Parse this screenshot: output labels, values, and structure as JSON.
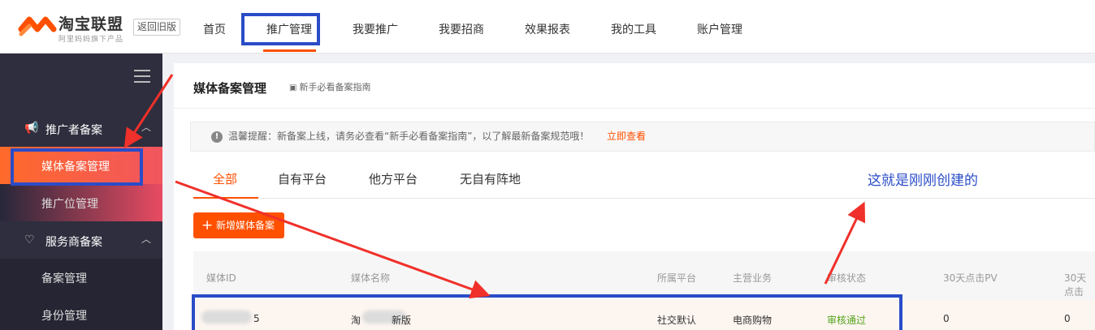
{
  "header": {
    "brand": "淘宝联盟",
    "brand_sub": "阿里妈妈旗下产品",
    "old_version": "返回旧版",
    "nav": [
      "首页",
      "推广管理",
      "我要推广",
      "我要招商",
      "效果报表",
      "我的工具",
      "账户管理"
    ]
  },
  "sidebar": {
    "groups": [
      {
        "label": "推广者备案",
        "items": [
          "媒体备案管理",
          "推广位管理"
        ]
      },
      {
        "label": "服务商备案",
        "items": [
          "备案管理",
          "身份管理"
        ]
      }
    ]
  },
  "main": {
    "title": "媒体备案管理",
    "guide_link": "新手必看备案指南",
    "notice_text": "温馨提醒：新备案上线，请务必查看“新手必看备案指南”，以了解最新备案规范哦！",
    "notice_link": "立即查看",
    "tabs": [
      "全部",
      "自有平台",
      "他方平台",
      "无自有阵地"
    ],
    "add_button": "新增媒体备案",
    "annotation": "这就是刚刚创建的",
    "table": {
      "headers": [
        "媒体ID",
        "媒体名称",
        "所属平台",
        "主营业务",
        "审核状态",
        "30天点击PV",
        "30天点击"
      ],
      "row": {
        "id": "5",
        "name_prefix": "淘",
        "name_suffix": "新版",
        "platform": "社交默认",
        "business": "电商购物",
        "status": "审核通过",
        "pv": "0",
        "pv2": "0"
      }
    }
  },
  "colors": {
    "accent": "#ff5000",
    "annotation": "#2a4cc8",
    "sidebar": "#2e2e3e",
    "status_ok": "#53a41c"
  }
}
